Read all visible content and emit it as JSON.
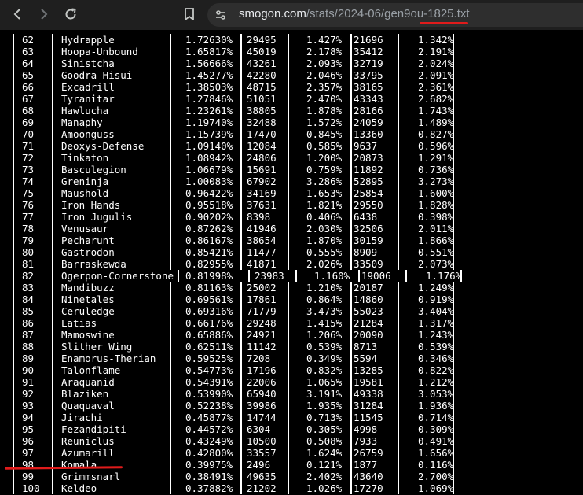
{
  "browser": {
    "url_host": "smogon.com",
    "url_path": "/stats/2024-06/gen9ou-1825.txt",
    "back_icon": "back-arrow-icon",
    "forward_icon": "forward-arrow-icon",
    "reload_icon": "reload-icon",
    "bookmark_icon": "bookmark-icon",
    "site_info_icon": "site-info-icon"
  },
  "rows": [
    {
      "rank": "62",
      "name": "Hydrapple",
      "usage": "1.72630%",
      "raw": "29495",
      "raw_pct": "1.427%",
      "real": "21696",
      "real_pct": "1.342%"
    },
    {
      "rank": "63",
      "name": "Hoopa-Unbound",
      "usage": "1.65817%",
      "raw": "45019",
      "raw_pct": "2.178%",
      "real": "35412",
      "real_pct": "2.191%"
    },
    {
      "rank": "64",
      "name": "Sinistcha",
      "usage": "1.56666%",
      "raw": "43261",
      "raw_pct": "2.093%",
      "real": "32719",
      "real_pct": "2.024%"
    },
    {
      "rank": "65",
      "name": "Goodra-Hisui",
      "usage": "1.45277%",
      "raw": "42280",
      "raw_pct": "2.046%",
      "real": "33795",
      "real_pct": "2.091%"
    },
    {
      "rank": "66",
      "name": "Excadrill",
      "usage": "1.38503%",
      "raw": "48715",
      "raw_pct": "2.357%",
      "real": "38165",
      "real_pct": "2.361%"
    },
    {
      "rank": "67",
      "name": "Tyranitar",
      "usage": "1.27846%",
      "raw": "51051",
      "raw_pct": "2.470%",
      "real": "43343",
      "real_pct": "2.682%"
    },
    {
      "rank": "68",
      "name": "Hawlucha",
      "usage": "1.23261%",
      "raw": "38805",
      "raw_pct": "1.878%",
      "real": "28166",
      "real_pct": "1.743%"
    },
    {
      "rank": "69",
      "name": "Manaphy",
      "usage": "1.19740%",
      "raw": "32488",
      "raw_pct": "1.572%",
      "real": "24059",
      "real_pct": "1.489%"
    },
    {
      "rank": "70",
      "name": "Amoonguss",
      "usage": "1.15739%",
      "raw": "17470",
      "raw_pct": "0.845%",
      "real": "13360",
      "real_pct": "0.827%"
    },
    {
      "rank": "71",
      "name": "Deoxys-Defense",
      "usage": "1.09140%",
      "raw": "12084",
      "raw_pct": "0.585%",
      "real": "9637",
      "real_pct": "0.596%"
    },
    {
      "rank": "72",
      "name": "Tinkaton",
      "usage": "1.08942%",
      "raw": "24806",
      "raw_pct": "1.200%",
      "real": "20873",
      "real_pct": "1.291%"
    },
    {
      "rank": "73",
      "name": "Basculegion",
      "usage": "1.06679%",
      "raw": "15691",
      "raw_pct": "0.759%",
      "real": "11892",
      "real_pct": "0.736%"
    },
    {
      "rank": "74",
      "name": "Greninja",
      "usage": "1.00083%",
      "raw": "67902",
      "raw_pct": "3.286%",
      "real": "52895",
      "real_pct": "3.273%"
    },
    {
      "rank": "75",
      "name": "Maushold",
      "usage": "0.96422%",
      "raw": "34169",
      "raw_pct": "1.653%",
      "real": "25854",
      "real_pct": "1.600%"
    },
    {
      "rank": "76",
      "name": "Iron Hands",
      "usage": "0.95518%",
      "raw": "37631",
      "raw_pct": "1.821%",
      "real": "29550",
      "real_pct": "1.828%"
    },
    {
      "rank": "77",
      "name": "Iron Jugulis",
      "usage": "0.90202%",
      "raw": "8398",
      "raw_pct": "0.406%",
      "real": "6438",
      "real_pct": "0.398%"
    },
    {
      "rank": "78",
      "name": "Venusaur",
      "usage": "0.87262%",
      "raw": "41946",
      "raw_pct": "2.030%",
      "real": "32506",
      "real_pct": "2.011%"
    },
    {
      "rank": "79",
      "name": "Pecharunt",
      "usage": "0.86167%",
      "raw": "38654",
      "raw_pct": "1.870%",
      "real": "30159",
      "real_pct": "1.866%"
    },
    {
      "rank": "80",
      "name": "Gastrodon",
      "usage": "0.85421%",
      "raw": "11477",
      "raw_pct": "0.555%",
      "real": "8909",
      "real_pct": "0.551%"
    },
    {
      "rank": "81",
      "name": "Barraskewda",
      "usage": "0.82955%",
      "raw": "41871",
      "raw_pct": "2.026%",
      "real": "33509",
      "real_pct": "2.073%"
    },
    {
      "rank": "82",
      "name": "Ogerpon-Cornerstone",
      "usage": "0.81998%",
      "raw": "23983",
      "raw_pct": "1.160%",
      "real": "19006",
      "real_pct": "1.176%",
      "wide": true
    },
    {
      "rank": "83",
      "name": "Mandibuzz",
      "usage": "0.81163%",
      "raw": "25002",
      "raw_pct": "1.210%",
      "real": "20187",
      "real_pct": "1.249%"
    },
    {
      "rank": "84",
      "name": "Ninetales",
      "usage": "0.69561%",
      "raw": "17861",
      "raw_pct": "0.864%",
      "real": "14860",
      "real_pct": "0.919%"
    },
    {
      "rank": "85",
      "name": "Ceruledge",
      "usage": "0.69316%",
      "raw": "71779",
      "raw_pct": "3.473%",
      "real": "55023",
      "real_pct": "3.404%"
    },
    {
      "rank": "86",
      "name": "Latias",
      "usage": "0.66176%",
      "raw": "29248",
      "raw_pct": "1.415%",
      "real": "21284",
      "real_pct": "1.317%"
    },
    {
      "rank": "87",
      "name": "Mamoswine",
      "usage": "0.65886%",
      "raw": "24921",
      "raw_pct": "1.206%",
      "real": "20090",
      "real_pct": "1.243%"
    },
    {
      "rank": "88",
      "name": "Slither Wing",
      "usage": "0.62511%",
      "raw": "11142",
      "raw_pct": "0.539%",
      "real": "8713",
      "real_pct": "0.539%"
    },
    {
      "rank": "89",
      "name": "Enamorus-Therian",
      "usage": "0.59525%",
      "raw": "7208",
      "raw_pct": "0.349%",
      "real": "5594",
      "real_pct": "0.346%"
    },
    {
      "rank": "90",
      "name": "Talonflame",
      "usage": "0.54773%",
      "raw": "17196",
      "raw_pct": "0.832%",
      "real": "13285",
      "real_pct": "0.822%"
    },
    {
      "rank": "91",
      "name": "Araquanid",
      "usage": "0.54391%",
      "raw": "22006",
      "raw_pct": "1.065%",
      "real": "19581",
      "real_pct": "1.212%"
    },
    {
      "rank": "92",
      "name": "Blaziken",
      "usage": "0.53990%",
      "raw": "65940",
      "raw_pct": "3.191%",
      "real": "49338",
      "real_pct": "3.053%"
    },
    {
      "rank": "93",
      "name": "Quaquaval",
      "usage": "0.52238%",
      "raw": "39986",
      "raw_pct": "1.935%",
      "real": "31284",
      "real_pct": "1.936%"
    },
    {
      "rank": "94",
      "name": "Jirachi",
      "usage": "0.45877%",
      "raw": "14744",
      "raw_pct": "0.713%",
      "real": "11545",
      "real_pct": "0.714%"
    },
    {
      "rank": "95",
      "name": "Fezandipiti",
      "usage": "0.44572%",
      "raw": "6304",
      "raw_pct": "0.305%",
      "real": "4998",
      "real_pct": "0.309%"
    },
    {
      "rank": "96",
      "name": "Reuniclus",
      "usage": "0.43249%",
      "raw": "10500",
      "raw_pct": "0.508%",
      "real": "7933",
      "real_pct": "0.491%"
    },
    {
      "rank": "97",
      "name": "Azumarill",
      "usage": "0.42800%",
      "raw": "33557",
      "raw_pct": "1.624%",
      "real": "26759",
      "real_pct": "1.656%"
    },
    {
      "rank": "98",
      "name": "Komala",
      "usage": "0.39975%",
      "raw": "2496",
      "raw_pct": "0.121%",
      "real": "1877",
      "real_pct": "0.116%"
    },
    {
      "rank": "99",
      "name": "Grimmsnarl",
      "usage": "0.38491%",
      "raw": "49635",
      "raw_pct": "2.402%",
      "real": "43640",
      "real_pct": "2.700%"
    },
    {
      "rank": "100",
      "name": "Keldeo",
      "usage": "0.37882%",
      "raw": "21202",
      "raw_pct": "1.026%",
      "real": "17270",
      "real_pct": "1.069%"
    }
  ]
}
